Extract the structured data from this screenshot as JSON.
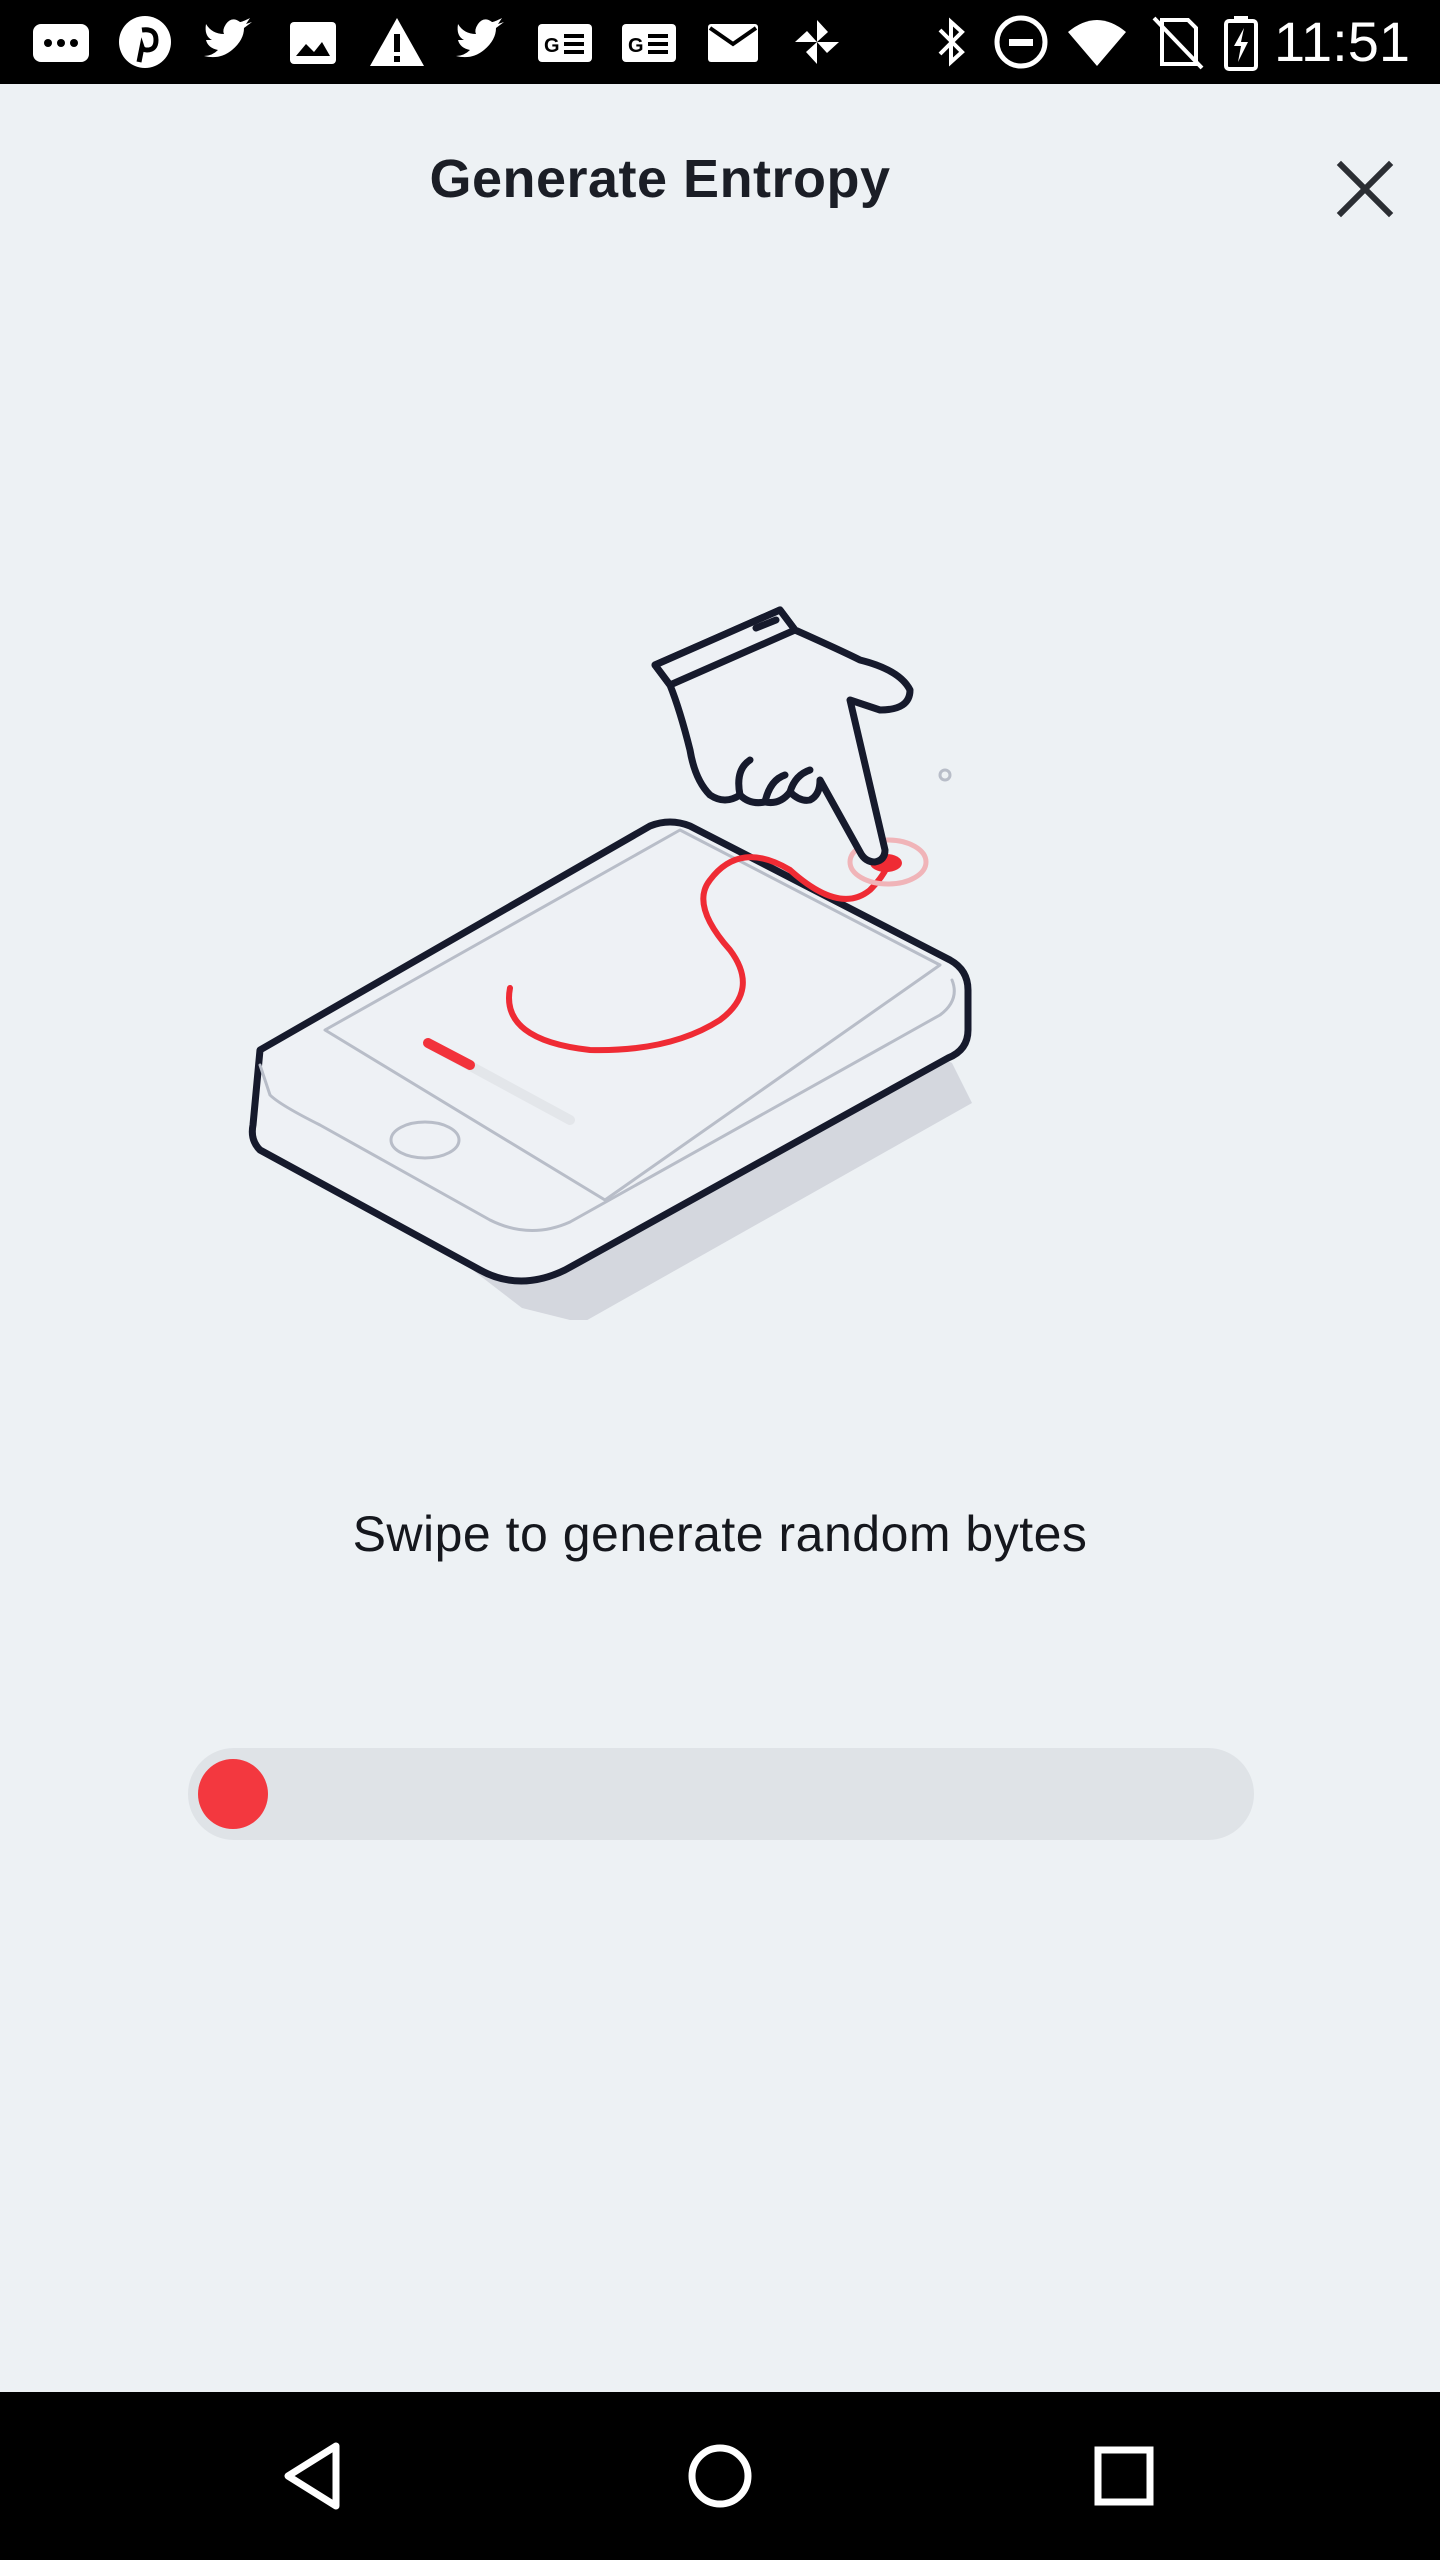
{
  "status_bar": {
    "time": "11:51",
    "notification_icons": [
      "messages-icon",
      "pinterest-icon",
      "twitter-icon",
      "image-icon",
      "warning-icon",
      "twitter-icon",
      "news-icon",
      "news-icon",
      "mail-icon",
      "pinwheel-icon"
    ],
    "system_icons": [
      "bluetooth-icon",
      "do-not-disturb-icon",
      "wifi-icon",
      "no-sim-icon",
      "battery-charging-icon"
    ]
  },
  "header": {
    "title": "Generate Entropy",
    "close_icon": "close-icon"
  },
  "main": {
    "illustration": "phone-swipe-illustration",
    "instruction": "Swipe to generate random bytes",
    "progress": {
      "value": 0.05,
      "color": "#f3383f",
      "track_color": "#dfe3e7"
    }
  },
  "nav_bar": {
    "buttons": [
      "back-icon",
      "home-icon",
      "recents-icon"
    ]
  },
  "colors": {
    "background": "#edf1f4",
    "accent": "#f3383f",
    "text": "#1b1e26"
  }
}
